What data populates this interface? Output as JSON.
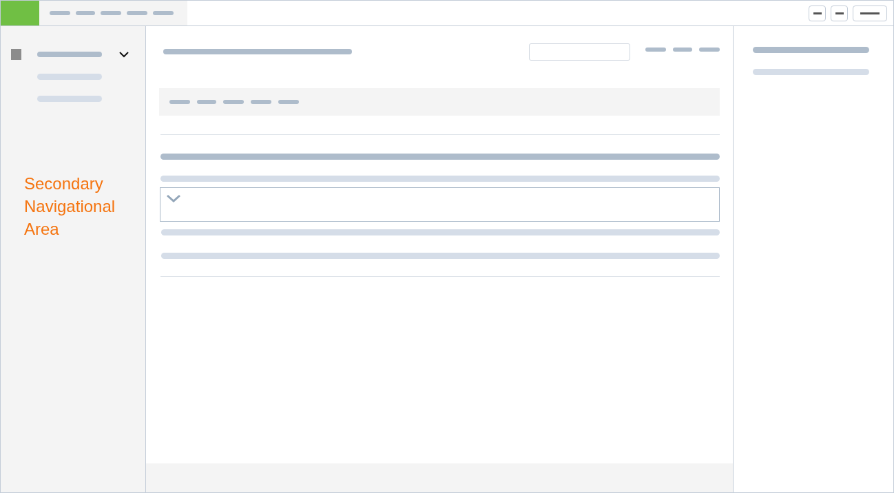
{
  "sidebar": {
    "area_label": "Secondary Navigational Area"
  }
}
